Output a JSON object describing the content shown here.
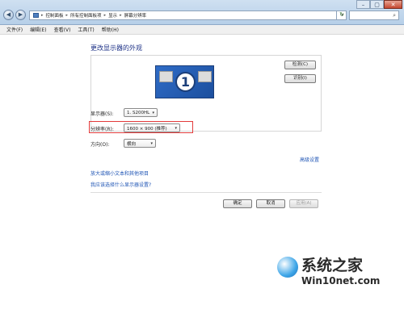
{
  "window": {
    "back_glyph": "◀",
    "forward_glyph": "▶",
    "minimize_glyph": "–",
    "maximize_glyph": "▢",
    "close_glyph": "✕"
  },
  "address_bar": {
    "breadcrumb": [
      "控制面板",
      "所有控制面板项",
      "显示",
      "屏幕分辨率"
    ],
    "separator": "▸",
    "dropdown_glyph": "▾",
    "refresh_glyph": "↻",
    "search_icon_glyph": "⌕"
  },
  "menu": {
    "file": "文件(F)",
    "edit": "编辑(E)",
    "view": "查看(V)",
    "tools": "工具(T)",
    "help": "帮助(H)"
  },
  "main": {
    "heading": "更改显示器的外观",
    "monitor_number": "1",
    "detect_button": "检测(C)",
    "identify_button": "识别(I)",
    "display_label": "显示器(S):",
    "display_value": "1. S200HL",
    "resolution_label": "分辨率(R):",
    "resolution_value": "1600 × 900 (推荐)",
    "orientation_label": "方向(O):",
    "orientation_value": "横向",
    "combo_arrow": "▾",
    "advanced_link": "高级设置",
    "text_size_link": "放大或缩小文本和其他项目",
    "which_setting_link": "我应该选择什么显示器设置?"
  },
  "footer": {
    "ok_button": "确定",
    "cancel_button": "取消",
    "apply_button": "应用(A)"
  },
  "watermark": {
    "brand": "系统之家",
    "site": "Win10net.com"
  },
  "colors": {
    "link": "#1f55b5",
    "heading": "#1e3287",
    "highlight_box": "#e23b3b",
    "monitor_blue": "#2f6cc7"
  }
}
